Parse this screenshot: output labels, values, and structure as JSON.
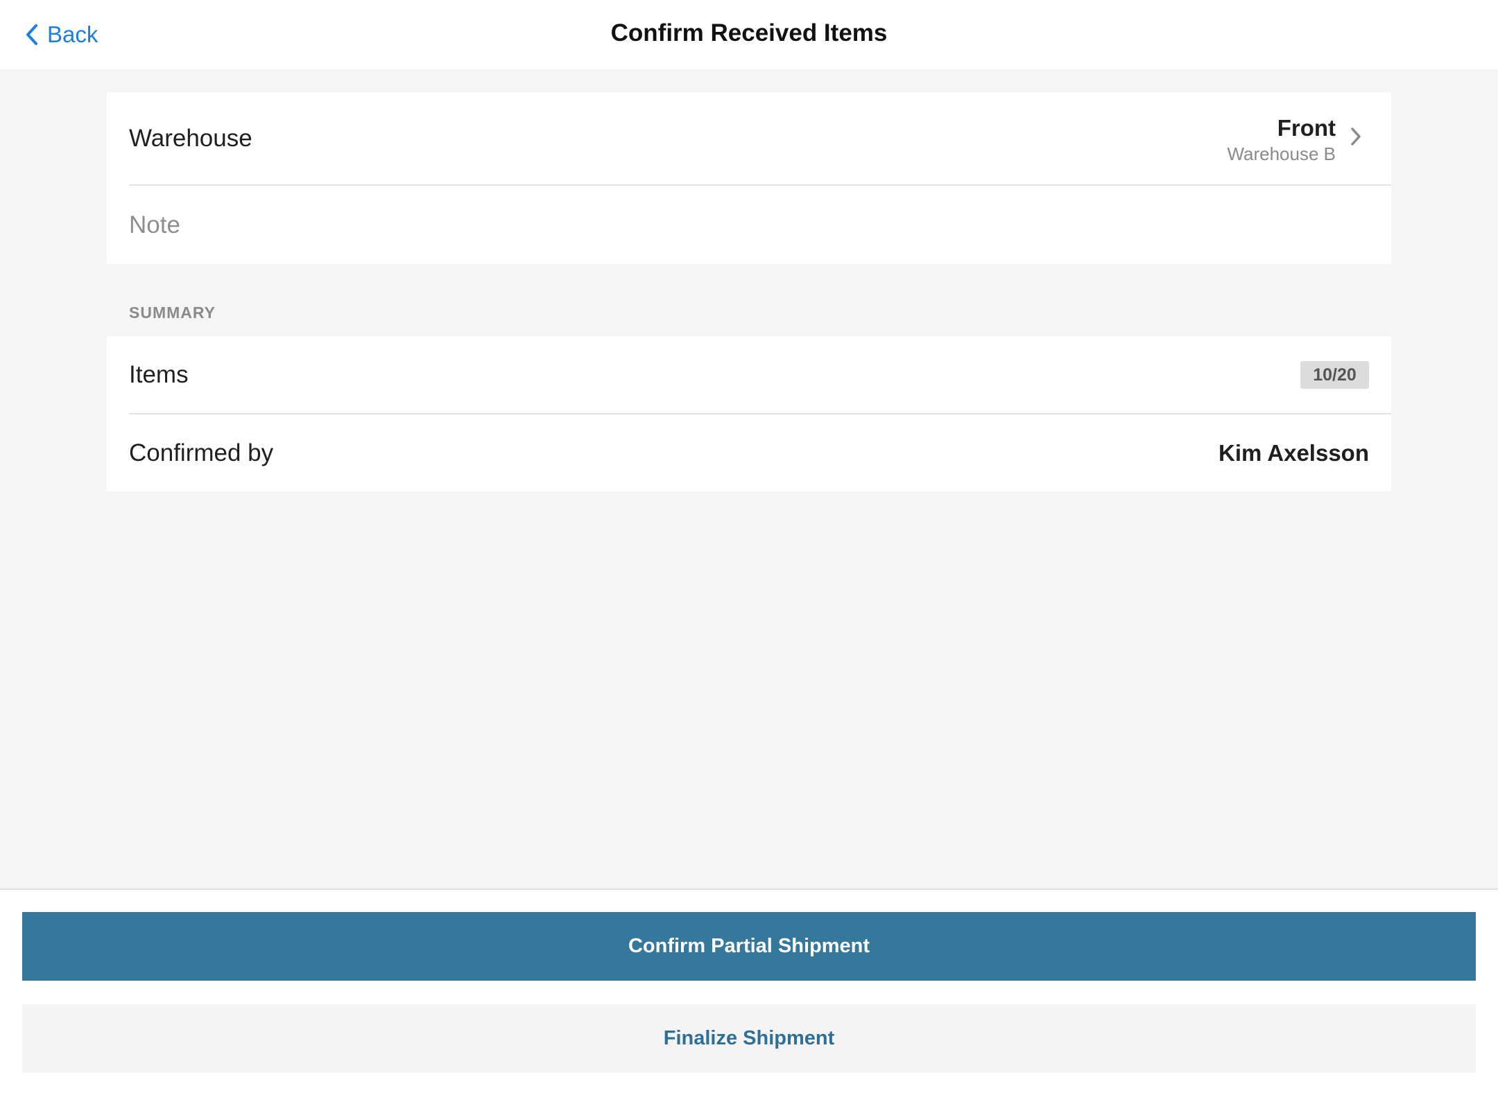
{
  "nav": {
    "back_label": "Back",
    "title": "Confirm Received Items"
  },
  "details": {
    "warehouse_label": "Warehouse",
    "warehouse_primary": "Front",
    "warehouse_secondary": "Warehouse B",
    "note_placeholder": "Note"
  },
  "summary": {
    "header": "SUMMARY",
    "items_label": "Items",
    "items_value": "10/20",
    "confirmed_label": "Confirmed by",
    "confirmed_value": "Kim Axelsson"
  },
  "actions": {
    "primary_label": "Confirm Partial Shipment",
    "secondary_label": "Finalize Shipment"
  },
  "colors": {
    "accent": "#1a7fe0",
    "primary_button": "#36779c",
    "secondary_button_text": "#2f6f95"
  },
  "icons": {
    "back": "chevron-left-icon",
    "disclosure": "chevron-right-icon"
  }
}
